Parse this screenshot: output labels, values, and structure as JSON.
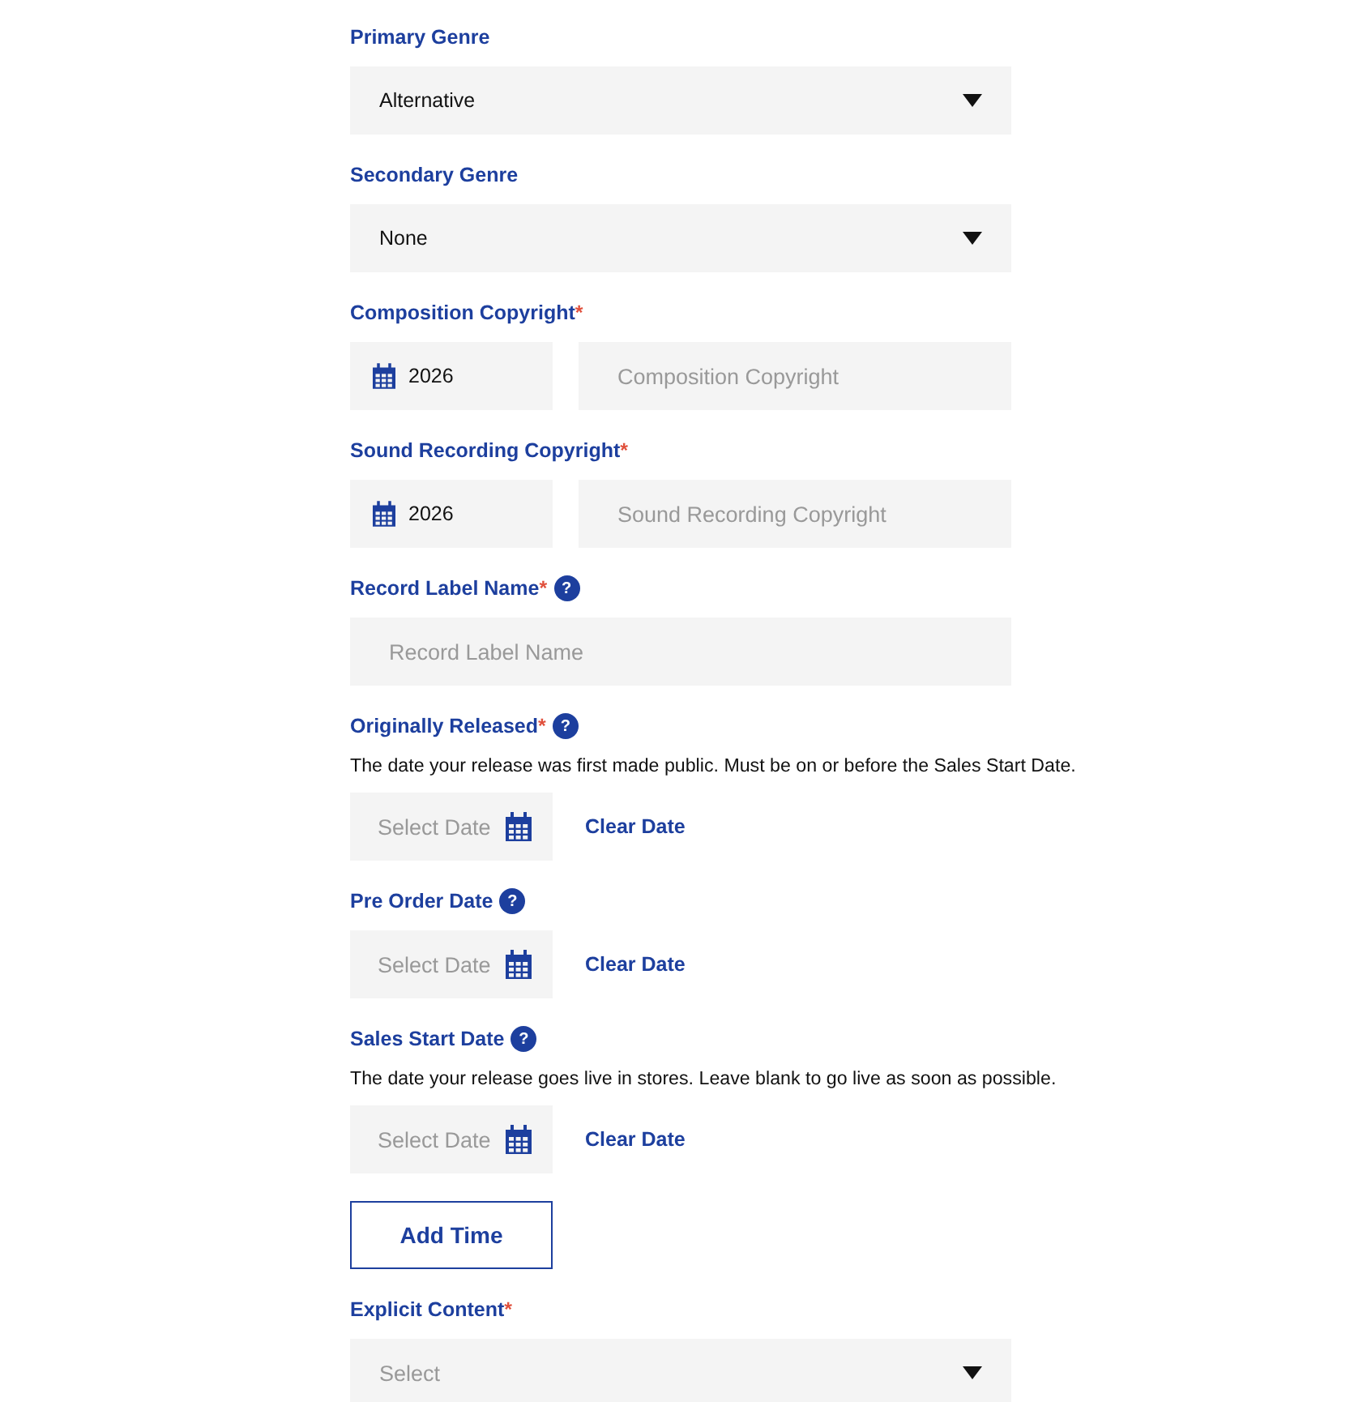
{
  "fields": [
    {
      "kind": "select",
      "label": "Primary Genre",
      "value": "Alternative"
    },
    {
      "kind": "select",
      "label": "Secondary Genre",
      "value": "None"
    },
    {
      "kind": "copyright",
      "label": "Composition Copyright",
      "required_mark": "*",
      "year": "2026",
      "placeholder": "Composition Copyright"
    },
    {
      "kind": "copyright",
      "label": "Sound Recording Copyright",
      "required_mark": "*",
      "year": "2026",
      "placeholder": "Sound Recording Copyright"
    },
    {
      "kind": "text",
      "label": "Record Label Name",
      "required_mark": "*",
      "help": "?",
      "placeholder": "Record Label Name"
    },
    {
      "kind": "date",
      "label": "Originally Released",
      "required_mark": "*",
      "help": "?",
      "description": "The date your release was first made public. Must be on or before the Sales Start Date.",
      "placeholder": "Select Date",
      "clear": "Clear Date"
    },
    {
      "kind": "date",
      "label": "Pre Order Date",
      "help": "?",
      "placeholder": "Select Date",
      "clear": "Clear Date"
    },
    {
      "kind": "date",
      "label": "Sales Start Date",
      "help": "?",
      "description": "The date your release goes live in stores. Leave blank to go live as soon as possible.",
      "placeholder": "Select Date",
      "clear": "Clear Date"
    },
    {
      "kind": "button",
      "label": "Add Time"
    },
    {
      "kind": "select",
      "label": "Explicit Content",
      "required_mark": "*",
      "placeholder": "Select"
    }
  ]
}
